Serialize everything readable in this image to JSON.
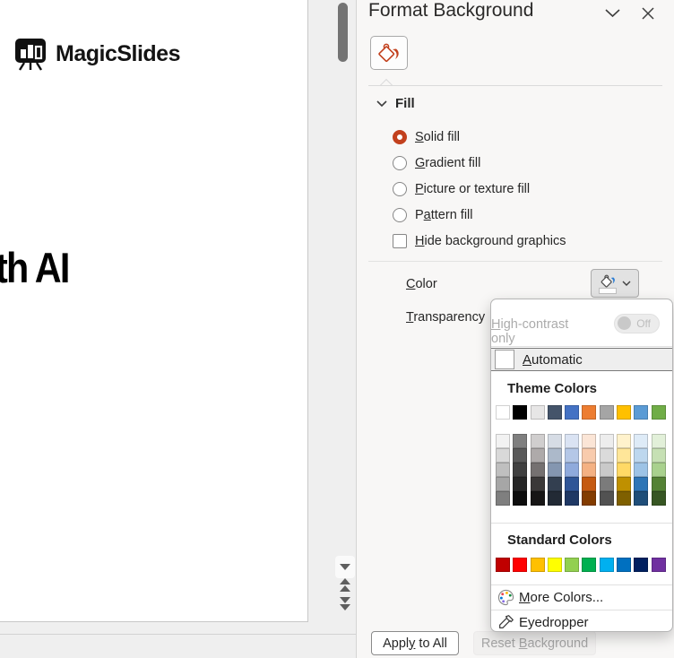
{
  "slide": {
    "logo_text": "MagicSlides",
    "headline_clipped": "th AI"
  },
  "panel": {
    "title": "Format Background",
    "fill_section_label": "Fill",
    "options": [
      {
        "pre": "",
        "key": "S",
        "post": "olid fill",
        "selected": true
      },
      {
        "pre": "",
        "key": "G",
        "post": "radient fill",
        "selected": false
      },
      {
        "pre": "",
        "key": "P",
        "post": "icture or texture fill",
        "selected": false
      },
      {
        "pre": "P",
        "key": "a",
        "post": "ttern fill",
        "selected": false
      }
    ],
    "hide_checkbox": {
      "pre": "",
      "key": "H",
      "post": "ide background graphics",
      "checked": false
    },
    "color_label": {
      "pre": "",
      "key": "C",
      "post": "olor"
    },
    "transparency_label": {
      "pre": "",
      "key": "T",
      "post": "ransparency"
    },
    "footer": {
      "apply": {
        "pre": "Appl",
        "key": "y",
        "post": " to All"
      },
      "reset": {
        "pre": "Reset ",
        "key": "B",
        "post": "ackground"
      }
    }
  },
  "dropdown": {
    "high_contrast": {
      "pre": "",
      "key": "H",
      "post": "igh-contrast only"
    },
    "toggle_state": "Off",
    "automatic": {
      "pre": "",
      "key": "A",
      "post": "utomatic"
    },
    "theme_header": "Theme Colors",
    "theme_colors": [
      "#FFFFFF",
      "#000000",
      "#E7E6E6",
      "#44546A",
      "#4472C4",
      "#ED7D31",
      "#A5A5A5",
      "#FFC000",
      "#5B9BD5",
      "#70AD47"
    ],
    "theme_variants": [
      [
        "#F2F2F2",
        "#7F7F7F",
        "#D0CECE",
        "#D6DCE5",
        "#DAE3F3",
        "#FBE5D6",
        "#EDEDED",
        "#FFF2CC",
        "#DEEBF7",
        "#E2F0D9"
      ],
      [
        "#D9D9D9",
        "#595959",
        "#AEAAAA",
        "#ACB9CA",
        "#B4C7E7",
        "#F8CBAD",
        "#DBDBDB",
        "#FFE699",
        "#BDD7EE",
        "#C6E0B4"
      ],
      [
        "#BFBFBF",
        "#404040",
        "#757171",
        "#8496B0",
        "#8FAADC",
        "#F4B183",
        "#C9C9C9",
        "#FFD966",
        "#9DC3E6",
        "#A9D18E"
      ],
      [
        "#A6A6A6",
        "#262626",
        "#3A3838",
        "#333F50",
        "#2F5597",
        "#C55A11",
        "#7B7B7B",
        "#BF9000",
        "#2E75B6",
        "#548235"
      ],
      [
        "#7F7F7F",
        "#0D0D0D",
        "#171616",
        "#222A35",
        "#1F3864",
        "#833C00",
        "#525252",
        "#7F6000",
        "#1F4E79",
        "#375623"
      ]
    ],
    "standard_header": "Standard Colors",
    "standard_colors": [
      "#C00000",
      "#FF0000",
      "#FFC000",
      "#FFFF00",
      "#92D050",
      "#00B050",
      "#00B0F0",
      "#0070C0",
      "#002060",
      "#7030A0"
    ],
    "more_colors": {
      "pre": "",
      "key": "M",
      "post": "ore Colors..."
    },
    "eyedropper_label": "Eyedropper"
  },
  "colors": {
    "accent": "#C2401D",
    "current_fill": "#FFFFFF"
  }
}
